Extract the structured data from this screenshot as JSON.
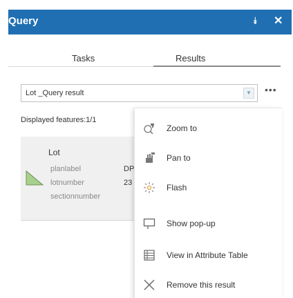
{
  "header": {
    "title": "Query",
    "collapse_icon": "double-chevron-up-icon",
    "close_icon": "close-icon",
    "color": "#1f6fb2"
  },
  "tabs": [
    {
      "label": "Tasks",
      "active": false
    },
    {
      "label": "Results",
      "active": true
    }
  ],
  "results_select": {
    "value": "Lot _Query result",
    "arrow_icon": "chevron-down-icon"
  },
  "more_button": {
    "icon": "ellipsis-icon",
    "label": "•••"
  },
  "features_count": "Displayed features:1/1",
  "result": {
    "title": "Lot",
    "shape_icon": "polygon-icon",
    "shape_color": "#a8d08d",
    "attributes": [
      {
        "name": "planlabel",
        "value": "DP"
      },
      {
        "name": "lotnumber",
        "value": "23"
      },
      {
        "name": "sectionnumber",
        "value": ""
      }
    ]
  },
  "menu": {
    "items": [
      {
        "label": "Zoom to",
        "icon": "zoom-to-icon"
      },
      {
        "label": "Pan to",
        "icon": "pan-to-icon"
      },
      {
        "label": "Flash",
        "icon": "flash-icon"
      },
      {
        "label": "Show pop-up",
        "icon": "popup-icon"
      },
      {
        "label": "View in Attribute Table",
        "icon": "table-icon"
      },
      {
        "label": "Remove this result",
        "icon": "remove-icon"
      }
    ]
  }
}
